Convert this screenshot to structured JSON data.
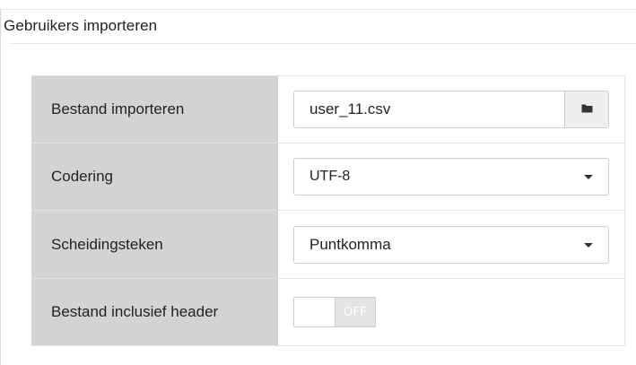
{
  "panel": {
    "title": "Gebruikers importeren"
  },
  "form": {
    "file_import": {
      "label": "Bestand importeren",
      "value": "user_11.csv",
      "browse_icon": "folder-icon"
    },
    "encoding": {
      "label": "Codering",
      "selected": "UTF-8"
    },
    "separator": {
      "label": "Scheidingsteken",
      "selected": "Puntkomma"
    },
    "header": {
      "label": "Bestand inclusief header",
      "toggle_state": "OFF"
    }
  },
  "colors": {
    "label_background": "#d3d3d3",
    "toggle_background": "#eeeeee",
    "border": "#cccccc"
  }
}
